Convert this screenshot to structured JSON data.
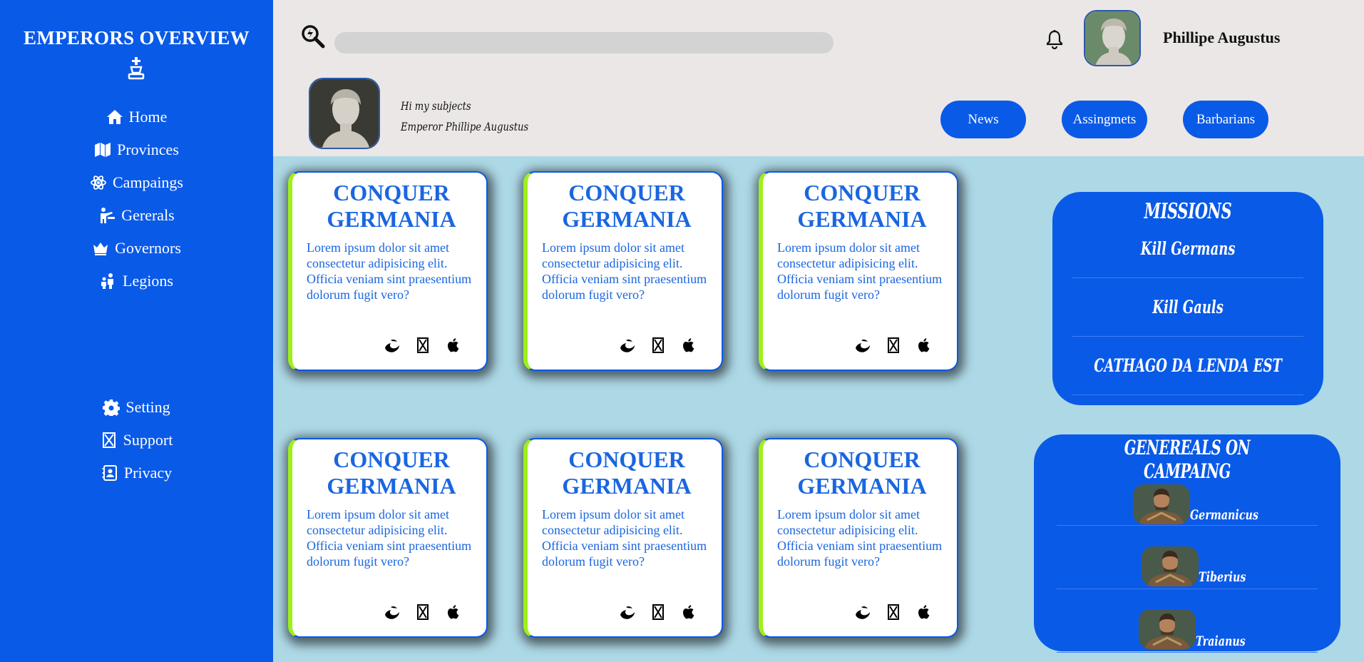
{
  "sidebar": {
    "brand": "EMPERORS OVERVIEW",
    "brand_icon": "chess-king-icon",
    "main_items": [
      {
        "label": "Home",
        "icon": "home-icon"
      },
      {
        "label": "Provinces",
        "icon": "map-icon"
      },
      {
        "label": "Campaings",
        "icon": "atom-icon"
      },
      {
        "label": "Gererals",
        "icon": "person-chalkboard-icon"
      },
      {
        "label": "Governors",
        "icon": "crown-icon"
      },
      {
        "label": "Legions",
        "icon": "people-group-icon"
      }
    ],
    "bottom_items": [
      {
        "label": "Setting",
        "icon": "gear-icon"
      },
      {
        "label": "Support",
        "icon": "support-box-icon"
      },
      {
        "label": "Privacy",
        "icon": "contact-card-icon"
      }
    ]
  },
  "header": {
    "search": {
      "value": "",
      "placeholder": ""
    },
    "user_name": "Phillipe Augustus",
    "welcome_line1": "Hi my subjects",
    "welcome_line2": "Emperor Phillipe Augustus",
    "buttons": [
      "News",
      "Assingmets",
      "Barbarians"
    ]
  },
  "cards": [
    {
      "title": "CONQUER GERMANIA",
      "body": "Lorem ipsum dolor sit amet consectetur adipisicing elit. Officia veniam sint praesentium dolorum fugit vero?"
    },
    {
      "title": "CONQUER GERMANIA",
      "body": "Lorem ipsum dolor sit amet consectetur adipisicing elit. Officia veniam sint praesentium dolorum fugit vero?"
    },
    {
      "title": "CONQUER GERMANIA",
      "body": "Lorem ipsum dolor sit amet consectetur adipisicing elit. Officia veniam sint praesentium dolorum fugit vero?"
    },
    {
      "title": "CONQUER GERMANIA",
      "body": "Lorem ipsum dolor sit amet consectetur adipisicing elit. Officia veniam sint praesentium dolorum fugit vero?"
    },
    {
      "title": "CONQUER GERMANIA",
      "body": "Lorem ipsum dolor sit amet consectetur adipisicing elit. Officia veniam sint praesentium dolorum fugit vero?"
    },
    {
      "title": "CONQUER GERMANIA",
      "body": "Lorem ipsum dolor sit amet consectetur adipisicing elit. Officia veniam sint praesentium dolorum fugit vero?"
    }
  ],
  "card_icons": [
    "edge-icon",
    "box-x-icon",
    "apple-icon"
  ],
  "missions": {
    "title": "MISSIONS",
    "items": [
      "Kill Germans",
      "Kill Gauls",
      "CATHAGO DA LENDA EST"
    ]
  },
  "generals": {
    "title": "GENEREALS ON CAMPAING",
    "items": [
      "Germanicus",
      "Tiberius",
      "Traianus"
    ]
  },
  "colors": {
    "sidebar": "#0a5ae8",
    "background": "#add8e6",
    "header": "#ebe7e7",
    "card_accent": "#9ef01a",
    "card_text": "#1a66e0"
  }
}
